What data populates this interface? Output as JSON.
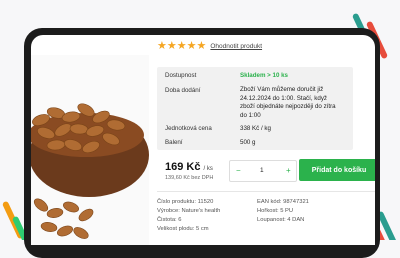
{
  "rating": {
    "stars": 5,
    "link_label": "Ohodnotit produkt"
  },
  "availability": {
    "label": "Dostupnost",
    "value": "Skladem > 10 ks"
  },
  "delivery": {
    "label": "Doba dodání",
    "value_lines": [
      "Zboží Vám můžeme doručit již",
      "24.12.2024 do 1:00. Stačí, když",
      "zboží objednáte nejpozději do zítra",
      "do 1:00"
    ]
  },
  "unit_price": {
    "label": "Jednotková cena",
    "value": "338 Kč / kg"
  },
  "package": {
    "label": "Balení",
    "value": "500 g"
  },
  "price": {
    "main": "169 Kč",
    "unit": "/ ks",
    "without_vat": "139,60 Kč bez DPH"
  },
  "quantity": {
    "minus": "−",
    "value": "1",
    "plus": "+"
  },
  "add_to_cart": {
    "label": "Přidat do košíku"
  },
  "specs": {
    "product_code": "Číslo produktu: 11520",
    "ean": "EAN kód: 98747321",
    "manufacturer": "Výrobce: Nature's health",
    "bitterness": "Hořkost: 5 PU",
    "purity": "Čistota: 6",
    "peelability": "Loupanost: 4 DAN",
    "fruit_size": "Velikost plodu: 5 cm"
  },
  "colors": {
    "accent_green": "#2bb24c",
    "star": "#f5a623"
  }
}
